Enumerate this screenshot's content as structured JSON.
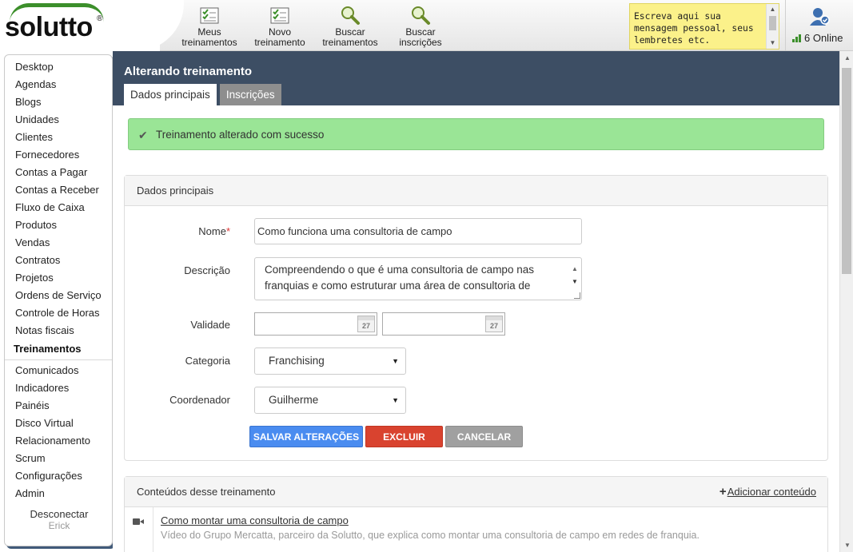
{
  "brand": {
    "name": "solutto",
    "reg": "®"
  },
  "top_nav": [
    {
      "line1": "Meus",
      "line2": "treinamentos",
      "icon": "checklist-icon"
    },
    {
      "line1": "Novo",
      "line2": "treinamento",
      "icon": "checklist-icon"
    },
    {
      "line1": "Buscar",
      "line2": "treinamentos",
      "icon": "search-icon"
    },
    {
      "line1": "Buscar",
      "line2": "inscrições",
      "icon": "search-icon"
    }
  ],
  "note": {
    "text": "Escreva aqui sua mensagem pessoal, seus lembretes etc."
  },
  "online": {
    "label": "6 Online",
    "icon": "user-check-icon"
  },
  "sidebar": {
    "items": [
      "Desktop",
      "Agendas",
      "Blogs",
      "Unidades",
      "Clientes",
      "Fornecedores",
      "Contas a Pagar",
      "Contas a Receber",
      "Fluxo de Caixa",
      "Produtos",
      "Vendas",
      "Contratos",
      "Projetos",
      "Ordens de Serviço",
      "Controle de Horas",
      "Notas fiscais"
    ],
    "active": "Treinamentos",
    "items_after": [
      "Comunicados",
      "Indicadores",
      "Painéis",
      "Disco Virtual",
      "Relacionamento",
      "Scrum",
      "Configurações",
      "Admin"
    ],
    "logout": "Desconectar",
    "user": "Erick"
  },
  "page": {
    "title": "Alterando treinamento",
    "tabs": [
      "Dados principais",
      "Inscrições"
    ]
  },
  "alert": {
    "message": "Treinamento alterado com sucesso"
  },
  "form": {
    "panel_title": "Dados principais",
    "name_label": "Nome",
    "name_required": "*",
    "name_value": "Como funciona uma consultoria de campo",
    "description_label": "Descrição",
    "description_value": "Compreendendo o que é uma consultoria de campo nas franquias e como estruturar uma área de consultoria de",
    "validity_label": "Validade",
    "calendar_day": "27",
    "category_label": "Categoria",
    "category_value": "Franchising",
    "coordinator_label": "Coordenador",
    "coordinator_value": "Guilherme",
    "save_label": "SALVAR ALTERAÇÕES",
    "delete_label": "EXCLUIR",
    "cancel_label": "CANCELAR"
  },
  "contents": {
    "panel_title": "Conteúdos desse treinamento",
    "add_label": "Adicionar conteúdo",
    "items": [
      {
        "title": "Como montar uma consultoria de campo",
        "description": "Vídeo do Grupo Mercatta, parceiro da Solutto, que explica como montar uma consultoria de campo em redes de franquia.",
        "icon": "video-camera-icon"
      }
    ]
  },
  "colors": {
    "header": "#3d4e64",
    "success": "#9ae596",
    "save": "#4a8cf0",
    "delete": "#d9432f",
    "cancel": "#a0a0a0",
    "brand_green": "#3c8f2b"
  }
}
